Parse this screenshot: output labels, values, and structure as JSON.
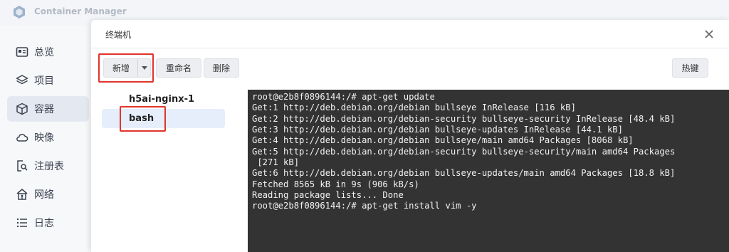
{
  "app": {
    "title": "Container Manager"
  },
  "sidebar": {
    "items": [
      {
        "label": "总览",
        "icon": "overview-icon"
      },
      {
        "label": "项目",
        "icon": "layers-icon"
      },
      {
        "label": "容器",
        "icon": "box-icon",
        "active": true
      },
      {
        "label": "映像",
        "icon": "cloud-icon"
      },
      {
        "label": "注册表",
        "icon": "registry-search-icon"
      },
      {
        "label": "网络",
        "icon": "network-icon"
      },
      {
        "label": "日志",
        "icon": "list-icon"
      }
    ]
  },
  "dialog": {
    "title": "终端机",
    "toolbar": {
      "new_label": "新增",
      "rename_label": "重命名",
      "delete_label": "删除",
      "hotkey_label": "热键"
    },
    "sessions": [
      {
        "label": "h5ai-nginx-1"
      },
      {
        "label": "bash",
        "selected": true
      }
    ],
    "terminal_lines": [
      "root@e2b8f0896144:/# apt-get update",
      "Get:1 http://deb.debian.org/debian bullseye InRelease [116 kB]",
      "Get:2 http://deb.debian.org/debian-security bullseye-security InRelease [48.4 kB]",
      "Get:3 http://deb.debian.org/debian bullseye-updates InRelease [44.1 kB]",
      "Get:4 http://deb.debian.org/debian bullseye/main amd64 Packages [8068 kB]",
      "Get:5 http://deb.debian.org/debian-security bullseye-security/main amd64 Packages",
      " [271 kB]",
      "Get:6 http://deb.debian.org/debian bullseye-updates/main amd64 Packages [18.8 kB]",
      "Fetched 8565 kB in 9s (906 kB/s)",
      "Reading package lists... Done",
      "root@e2b8f0896144:/# apt-get install vim -y"
    ]
  },
  "colors": {
    "highlight": "#e0342b",
    "terminal_bg": "#333333",
    "terminal_fg": "#f2f2f2"
  }
}
